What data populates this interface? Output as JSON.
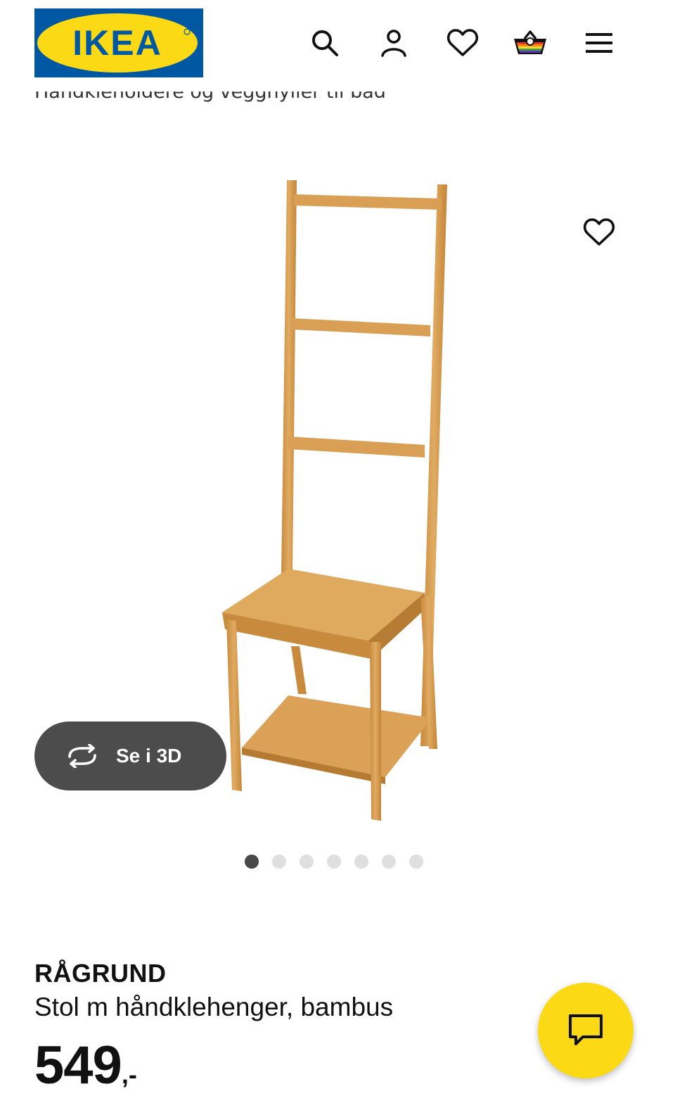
{
  "header": {
    "logo_text": "IKEA",
    "icons": [
      "search-icon",
      "account-icon",
      "favourites-icon",
      "cart-icon",
      "menu-icon"
    ]
  },
  "breadcrumb": "Håndkleholdere og veggnyller til bad",
  "gallery": {
    "view_3d_label": "Se i 3D",
    "image_count": 7,
    "active_index": 0
  },
  "product": {
    "name": "RÅGRUND",
    "description": "Stol m håndklehenger, bambus",
    "price": "549",
    "price_suffix": ",-"
  },
  "colors": {
    "ikea_blue": "#0058a3",
    "ikea_yellow": "#fbd914",
    "button_dark": "#4c4c4c",
    "bamboo": "#d59d52"
  }
}
